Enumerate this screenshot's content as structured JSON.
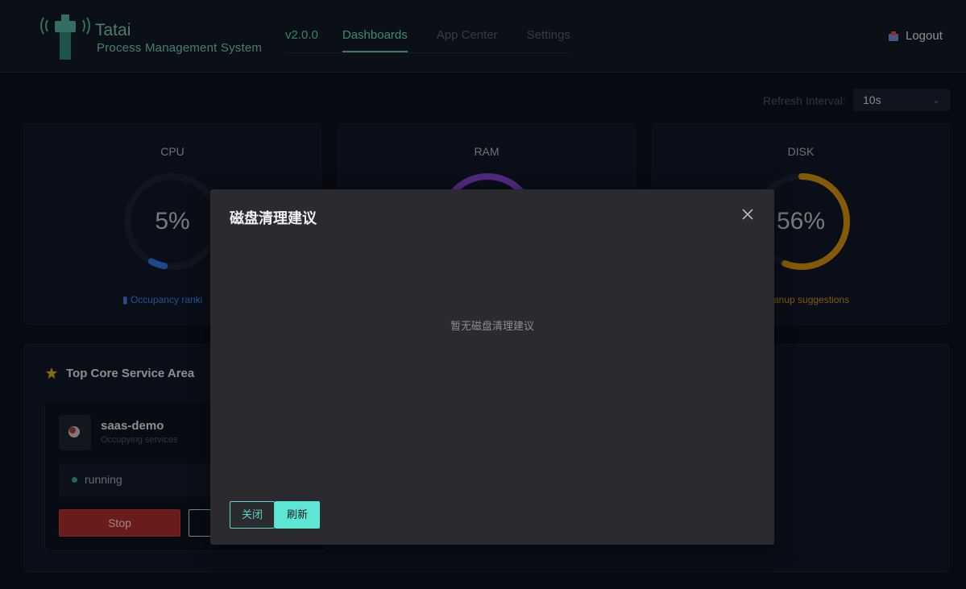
{
  "header": {
    "brand_name": "Tatai",
    "brand_sub": "Process Management System",
    "version": "v2.0.0",
    "tabs": [
      {
        "label": "Dashboards",
        "active": true
      },
      {
        "label": "App Center",
        "active": false
      },
      {
        "label": "Settings",
        "active": false
      }
    ],
    "logout_label": "Logout"
  },
  "refresh": {
    "label": "Refresh Interval:",
    "value": "10s"
  },
  "metrics": {
    "cpu": {
      "title": "CPU",
      "value": "5%",
      "percent": 5,
      "color": "#2f6fd0",
      "link": "Occupancy ranki"
    },
    "ram": {
      "title": "RAM",
      "color": "#7b3fc4"
    },
    "disk": {
      "title": "DISK",
      "value": "56%",
      "percent": 56,
      "color": "#c98a0c",
      "link": "anup suggestions"
    }
  },
  "service_area": {
    "title": "Top Core Service Area",
    "service": {
      "name": "saas-demo",
      "subtitle": "Occupying services",
      "status": "running",
      "stop_label": "Stop"
    }
  },
  "modal": {
    "title": "磁盘清理建议",
    "empty_text": "暂无磁盘清理建议",
    "close_label": "关闭",
    "refresh_label": "刷新"
  },
  "colors": {
    "accent": "#5ccfbf",
    "danger": "#a32a2a"
  }
}
